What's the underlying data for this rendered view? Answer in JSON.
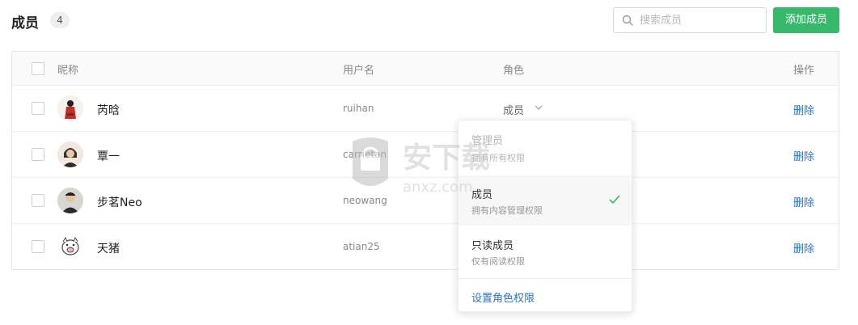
{
  "header": {
    "title": "成员",
    "count": "4",
    "search_placeholder": "搜索成员",
    "add_button": "添加成员"
  },
  "table": {
    "columns": {
      "nickname": "昵称",
      "username": "用户名",
      "role": "角色",
      "actions": "操作"
    },
    "rows": [
      {
        "nickname": "芮晗",
        "username": "ruihan",
        "role": "成员",
        "action": "删除"
      },
      {
        "nickname": "覃一",
        "username": "carrietan",
        "role": "",
        "action": "删除"
      },
      {
        "nickname": "步茗Neo",
        "username": "neowang",
        "role": "",
        "action": "删除"
      },
      {
        "nickname": "天猪",
        "username": "atian25",
        "role": "",
        "action": "删除"
      }
    ]
  },
  "role_dropdown": {
    "options": [
      {
        "title": "管理员",
        "desc": "拥有所有权限"
      },
      {
        "title": "成员",
        "desc": "拥有内容管理权限"
      },
      {
        "title": "只读成员",
        "desc": "仅有阅读权限"
      }
    ],
    "selected": "成员",
    "settings_link": "设置角色权限"
  },
  "watermark": {
    "text": "安下载",
    "url": "anxz.com"
  },
  "colors": {
    "primary_green": "#36b96b",
    "link_blue": "#2f72c4"
  }
}
